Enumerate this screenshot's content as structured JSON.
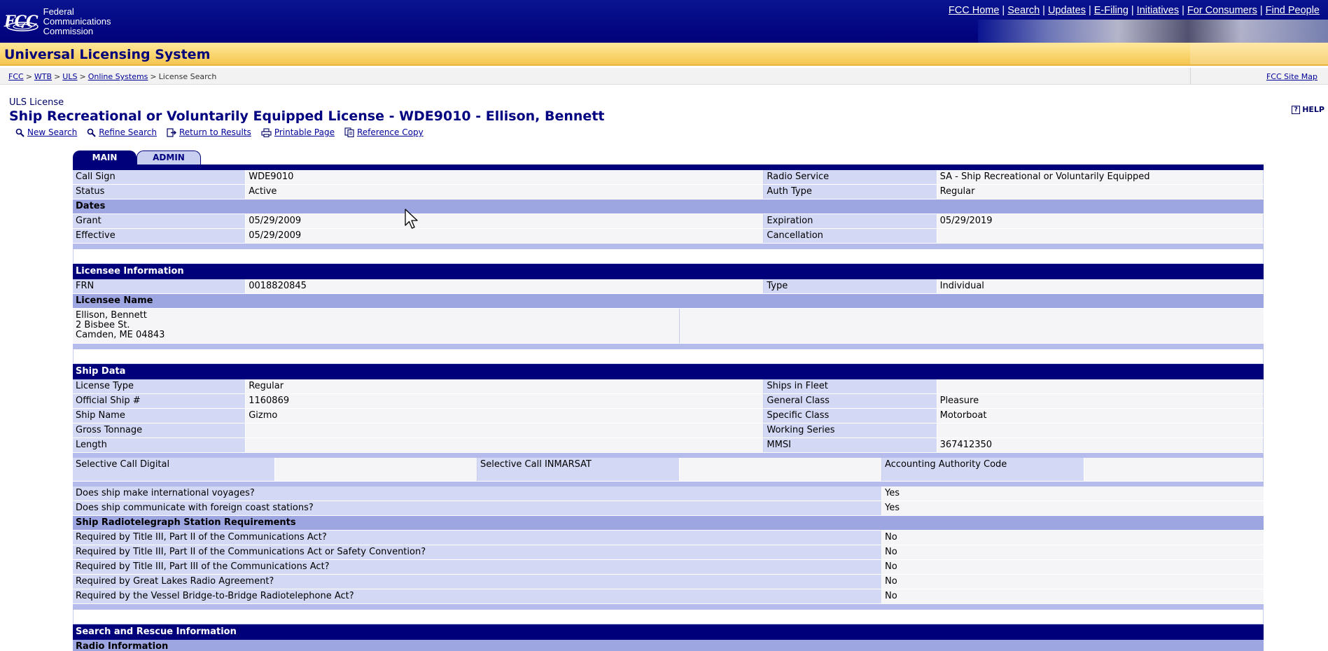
{
  "header": {
    "logo_mark": "FCC",
    "logo_words": [
      "Federal",
      "Communications",
      "Commission"
    ],
    "nav": [
      "FCC Home",
      "Search",
      "Updates",
      "E-Filing",
      "Initiatives",
      "For Consumers",
      "Find People"
    ],
    "banner_title": "Universal Licensing System"
  },
  "breadcrumb": {
    "items": [
      "FCC",
      "WTB",
      "ULS",
      "Online Systems"
    ],
    "current": "License Search",
    "site_map": "FCC Site Map"
  },
  "page": {
    "label": "ULS License",
    "title": "Ship Recreational or Voluntarily Equipped License - WDE9010 - Ellison, Bennett",
    "help": "HELP",
    "actions": [
      "New Search",
      "Refine Search",
      "Return to Results",
      "Printable Page",
      "Reference Copy"
    ]
  },
  "tabs": [
    "MAIN",
    "ADMIN"
  ],
  "general": {
    "rows": [
      {
        "l1": "Call Sign",
        "v1": "WDE9010",
        "l2": "Radio Service",
        "v2": "SA - Ship Recreational or Voluntarily Equipped"
      },
      {
        "l1": "Status",
        "v1": "Active",
        "l2": "Auth Type",
        "v2": "Regular"
      }
    ],
    "dates_head": "Dates",
    "date_rows": [
      {
        "l1": "Grant",
        "v1": "05/29/2009",
        "l2": "Expiration",
        "v2": "05/29/2019"
      },
      {
        "l1": "Effective",
        "v1": "05/29/2009",
        "l2": "Cancellation",
        "v2": ""
      }
    ]
  },
  "licensee": {
    "head": "Licensee Information",
    "frn_label": "FRN",
    "frn": "0018820845",
    "type_label": "Type",
    "type": "Individual",
    "name_head": "Licensee Name",
    "address": [
      "Ellison, Bennett",
      "2 Bisbee St.",
      "Camden, ME 04843"
    ]
  },
  "ship": {
    "head": "Ship Data",
    "rows": [
      {
        "l1": "License Type",
        "v1": "Regular",
        "l2": "Ships in Fleet",
        "v2": ""
      },
      {
        "l1": "Official Ship #",
        "v1": "1160869",
        "l2": "General Class",
        "v2": "Pleasure"
      },
      {
        "l1": "Ship Name",
        "v1": "Gizmo",
        "l2": "Specific Class",
        "v2": "Motorboat"
      },
      {
        "l1": "Gross Tonnage",
        "v1": "",
        "l2": "Working Series",
        "v2": ""
      },
      {
        "l1": "Length",
        "v1": "",
        "l2": "MMSI",
        "v2": "367412350"
      }
    ],
    "selective_call_digital": "Selective Call Digital",
    "selective_call_inmarsat": "Selective Call INMARSAT",
    "accounting_authority": "Accounting Authority Code",
    "questions": [
      {
        "q": "Does ship make international voyages?",
        "a": "Yes"
      },
      {
        "q": "Does ship communicate with foreign coast stations?",
        "a": "Yes"
      }
    ]
  },
  "radiotelegraph": {
    "head": "Ship Radiotelegraph Station Requirements",
    "rows": [
      {
        "q": "Required by Title III, Part II of the Communications Act?",
        "a": "No"
      },
      {
        "q": "Required by Title III, Part II of the Communications Act or Safety Convention?",
        "a": "No"
      },
      {
        "q": "Required by Title III, Part III of the Communications Act?",
        "a": "No"
      },
      {
        "q": "Required by Great Lakes Radio Agreement?",
        "a": "No"
      },
      {
        "q": "Required by the Vessel Bridge-to-Bridge Radiotelephone Act?",
        "a": "No"
      }
    ]
  },
  "search_rescue": {
    "head": "Search and Rescue Information",
    "sub": "Radio Information"
  },
  "colors": {
    "navy": "#00007a",
    "label_bg": "#d3d8f4",
    "subhead_bg": "#9ea6e2",
    "banner_gold": "#f5c650"
  }
}
